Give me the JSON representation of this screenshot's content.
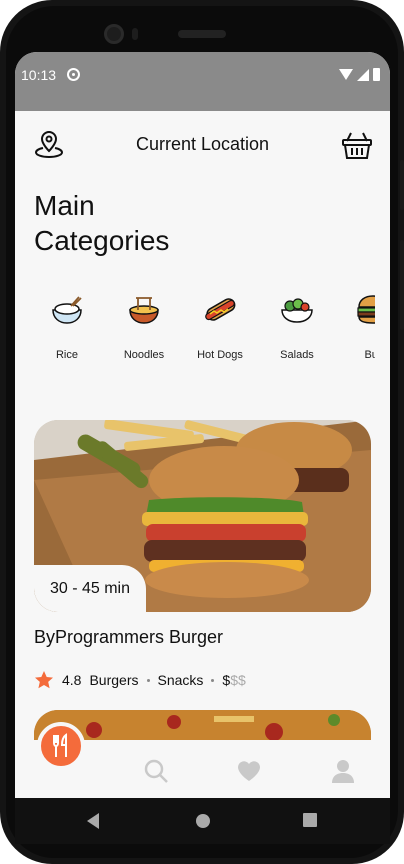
{
  "status": {
    "time": "10:13"
  },
  "header": {
    "title": "Current Location"
  },
  "heading": "Main Categories",
  "categories": [
    {
      "label": "Rice",
      "icon": "rice-bowl-icon"
    },
    {
      "label": "Noodles",
      "icon": "noodles-icon"
    },
    {
      "label": "Hot Dogs",
      "icon": "hot-dog-icon"
    },
    {
      "label": "Salads",
      "icon": "salad-icon"
    },
    {
      "label": "Bur",
      "icon": "burger-icon"
    }
  ],
  "restaurant": {
    "duration": "30 - 45 min",
    "name": "ByProgrammers Burger",
    "rating": "4.8",
    "tags": [
      "Burgers",
      "Snacks"
    ],
    "price_active": "$",
    "price_dim": "$$"
  },
  "nav": {
    "active_color": "#f46b3b"
  }
}
